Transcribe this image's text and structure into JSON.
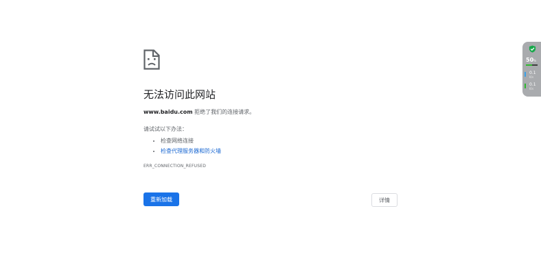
{
  "error_page": {
    "title": "无法访问此网站",
    "host": "www.baidu.com",
    "summary_rest": " 拒绝了我们的连接请求。",
    "try_label": "请试试以下办法：",
    "suggestions": [
      {
        "label": "检查网络连接",
        "link": false
      },
      {
        "label": "检查代理服务器和防火墙",
        "link": true
      }
    ],
    "error_code": "ERR_CONNECTION_REFUSED",
    "reload_label": "重新加载",
    "details_label": "详情"
  },
  "net_widget": {
    "percent": "50",
    "percent_unit": "%",
    "usage_fraction": 0.5,
    "upload_value": "0.1",
    "upload_unit": "K/s",
    "download_value": "0.1",
    "download_unit": "K/s",
    "colors": {
      "shield": "#18a84b",
      "upload_arrow": "#3aa0e8",
      "download_arrow": "#2eb82e",
      "bar_fill": "#2eb82e"
    }
  },
  "colors": {
    "primary_button": "#1a73e8",
    "link": "#1967d2",
    "text_secondary": "#5f6368"
  }
}
